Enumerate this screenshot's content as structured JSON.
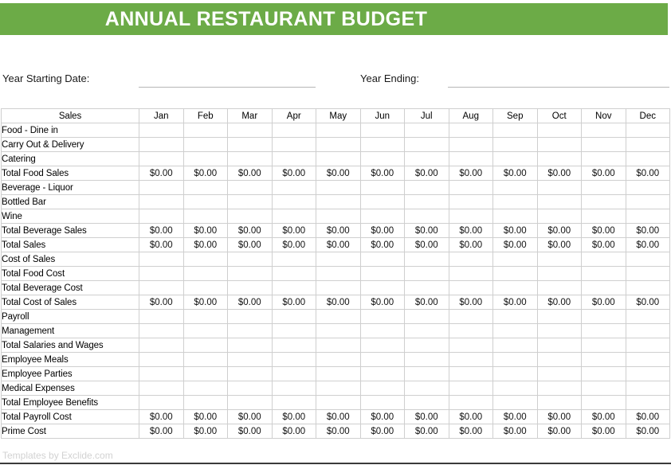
{
  "document": {
    "title": "ANNUAL RESTAURANT BUDGET",
    "accent_color": "#6cab47",
    "title_color": "#ffffff",
    "footer_credit": "Templates by Exclide.com"
  },
  "form": {
    "start_label": "Year Starting Date:",
    "start_value": "",
    "end_label": "Year Ending:",
    "end_value": ""
  },
  "table": {
    "corner_header": "Sales",
    "months": [
      "Jan",
      "Feb",
      "Mar",
      "Apr",
      "May",
      "Jun",
      "Jul",
      "Aug",
      "Sep",
      "Oct",
      "Nov",
      "Dec"
    ],
    "zero_value": "$0.00",
    "rows": [
      {
        "label": "Food - Dine in",
        "bold": false,
        "total": false,
        "values": [
          "",
          "",
          "",
          "",
          "",
          "",
          "",
          "",
          "",
          "",
          "",
          ""
        ]
      },
      {
        "label": "Carry Out & Delivery",
        "bold": false,
        "total": false,
        "values": [
          "",
          "",
          "",
          "",
          "",
          "",
          "",
          "",
          "",
          "",
          "",
          ""
        ]
      },
      {
        "label": "Catering",
        "bold": false,
        "total": false,
        "values": [
          "",
          "",
          "",
          "",
          "",
          "",
          "",
          "",
          "",
          "",
          "",
          ""
        ]
      },
      {
        "label": "Total Food Sales",
        "bold": true,
        "total": true,
        "values": [
          "$0.00",
          "$0.00",
          "$0.00",
          "$0.00",
          "$0.00",
          "$0.00",
          "$0.00",
          "$0.00",
          "$0.00",
          "$0.00",
          "$0.00",
          "$0.00"
        ]
      },
      {
        "label": "Beverage - Liquor",
        "bold": false,
        "total": false,
        "values": [
          "",
          "",
          "",
          "",
          "",
          "",
          "",
          "",
          "",
          "",
          "",
          ""
        ]
      },
      {
        "label": "Bottled Bar",
        "bold": false,
        "total": false,
        "values": [
          "",
          "",
          "",
          "",
          "",
          "",
          "",
          "",
          "",
          "",
          "",
          ""
        ]
      },
      {
        "label": "Wine",
        "bold": false,
        "total": false,
        "values": [
          "",
          "",
          "",
          "",
          "",
          "",
          "",
          "",
          "",
          "",
          "",
          ""
        ]
      },
      {
        "label": "Total Beverage Sales",
        "bold": true,
        "total": true,
        "values": [
          "$0.00",
          "$0.00",
          "$0.00",
          "$0.00",
          "$0.00",
          "$0.00",
          "$0.00",
          "$0.00",
          "$0.00",
          "$0.00",
          "$0.00",
          "$0.00"
        ]
      },
      {
        "label": "Total Sales",
        "bold": true,
        "total": true,
        "values": [
          "$0.00",
          "$0.00",
          "$0.00",
          "$0.00",
          "$0.00",
          "$0.00",
          "$0.00",
          "$0.00",
          "$0.00",
          "$0.00",
          "$0.00",
          "$0.00"
        ]
      },
      {
        "label": "Cost of Sales",
        "bold": true,
        "total": false,
        "values": [
          "",
          "",
          "",
          "",
          "",
          "",
          "",
          "",
          "",
          "",
          "",
          ""
        ]
      },
      {
        "label": "Total Food Cost",
        "bold": false,
        "total": false,
        "values": [
          "",
          "",
          "",
          "",
          "",
          "",
          "",
          "",
          "",
          "",
          "",
          ""
        ]
      },
      {
        "label": "Total Beverage Cost",
        "bold": false,
        "total": false,
        "values": [
          "",
          "",
          "",
          "",
          "",
          "",
          "",
          "",
          "",
          "",
          "",
          ""
        ]
      },
      {
        "label": "Total Cost of Sales",
        "bold": true,
        "total": true,
        "values": [
          "$0.00",
          "$0.00",
          "$0.00",
          "$0.00",
          "$0.00",
          "$0.00",
          "$0.00",
          "$0.00",
          "$0.00",
          "$0.00",
          "$0.00",
          "$0.00"
        ]
      },
      {
        "label": "Payroll",
        "bold": true,
        "total": false,
        "values": [
          "",
          "",
          "",
          "",
          "",
          "",
          "",
          "",
          "",
          "",
          "",
          ""
        ]
      },
      {
        "label": "Management",
        "bold": false,
        "total": false,
        "values": [
          "",
          "",
          "",
          "",
          "",
          "",
          "",
          "",
          "",
          "",
          "",
          ""
        ]
      },
      {
        "label": "Total Salaries and Wages",
        "bold": false,
        "total": false,
        "values": [
          "",
          "",
          "",
          "",
          "",
          "",
          "",
          "",
          "",
          "",
          "",
          ""
        ]
      },
      {
        "label": "Employee Meals",
        "bold": false,
        "total": false,
        "values": [
          "",
          "",
          "",
          "",
          "",
          "",
          "",
          "",
          "",
          "",
          "",
          ""
        ]
      },
      {
        "label": "Employee Parties",
        "bold": false,
        "total": false,
        "values": [
          "",
          "",
          "",
          "",
          "",
          "",
          "",
          "",
          "",
          "",
          "",
          ""
        ]
      },
      {
        "label": "Medical Expenses",
        "bold": false,
        "total": false,
        "values": [
          "",
          "",
          "",
          "",
          "",
          "",
          "",
          "",
          "",
          "",
          "",
          ""
        ]
      },
      {
        "label": "Total Employee Benefits",
        "bold": false,
        "total": false,
        "values": [
          "",
          "",
          "",
          "",
          "",
          "",
          "",
          "",
          "",
          "",
          "",
          ""
        ]
      },
      {
        "label": "Total Payroll Cost",
        "bold": true,
        "total": true,
        "values": [
          "$0.00",
          "$0.00",
          "$0.00",
          "$0.00",
          "$0.00",
          "$0.00",
          "$0.00",
          "$0.00",
          "$0.00",
          "$0.00",
          "$0.00",
          "$0.00"
        ]
      },
      {
        "label": "Prime Cost",
        "bold": true,
        "total": true,
        "values": [
          "$0.00",
          "$0.00",
          "$0.00",
          "$0.00",
          "$0.00",
          "$0.00",
          "$0.00",
          "$0.00",
          "$0.00",
          "$0.00",
          "$0.00",
          "$0.00"
        ]
      }
    ]
  }
}
